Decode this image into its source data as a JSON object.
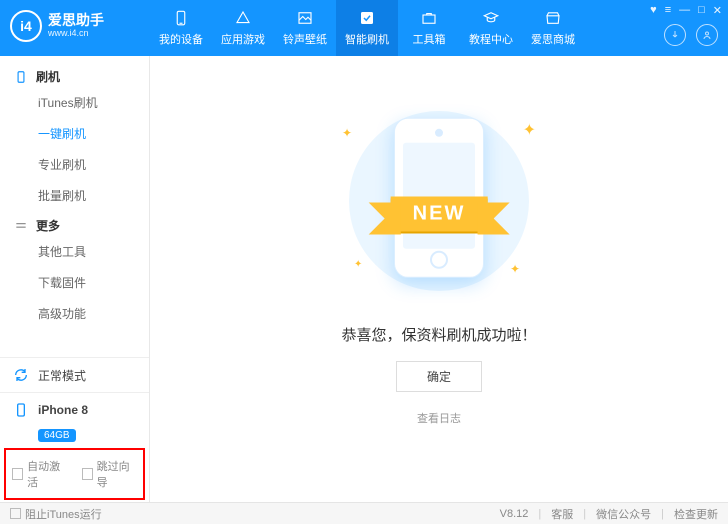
{
  "logo": {
    "mark": "i4",
    "title": "爱思助手",
    "sub": "www.i4.cn"
  },
  "nav": [
    {
      "label": "我的设备"
    },
    {
      "label": "应用游戏"
    },
    {
      "label": "铃声壁纸"
    },
    {
      "label": "智能刷机",
      "active": true
    },
    {
      "label": "工具箱"
    },
    {
      "label": "教程中心"
    },
    {
      "label": "爱思商城"
    }
  ],
  "sidebar": {
    "sections": [
      {
        "title": "刷机",
        "items": [
          "iTunes刷机",
          "一键刷机",
          "专业刷机",
          "批量刷机"
        ],
        "activeIndex": 1
      },
      {
        "title": "更多",
        "items": [
          "其他工具",
          "下载固件",
          "高级功能"
        ],
        "activeIndex": -1
      }
    ],
    "mode": "正常模式",
    "device": {
      "name": "iPhone 8",
      "storage": "64GB"
    },
    "checks": {
      "autoActivate": "自动激活",
      "skipGuide": "跳过向导"
    }
  },
  "content": {
    "ribbon": "NEW",
    "message": "恭喜您，保资料刷机成功啦！",
    "ok": "确定",
    "viewLog": "查看日志"
  },
  "footer": {
    "blockItunes": "阻止iTunes运行",
    "version": "V8.12",
    "service": "客服",
    "wechat": "微信公众号",
    "update": "检查更新"
  }
}
